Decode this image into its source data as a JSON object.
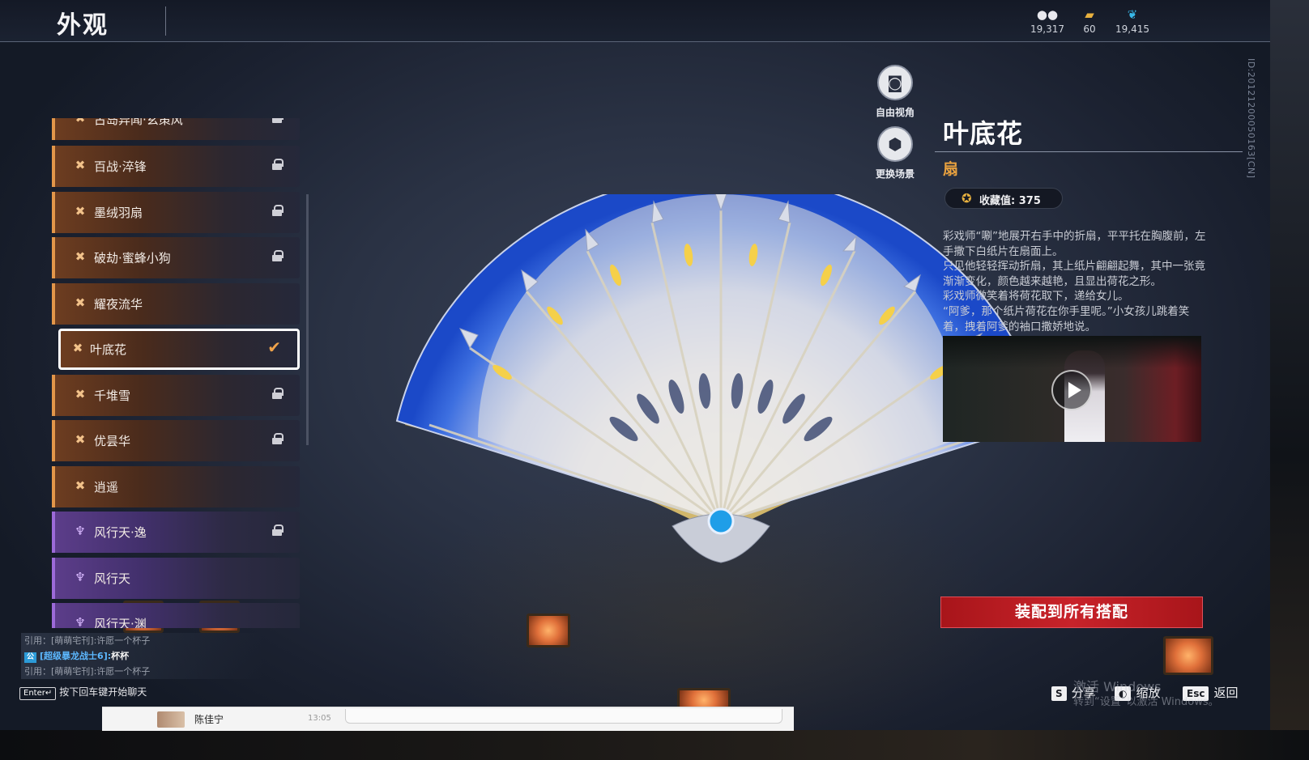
{
  "header": {
    "title": "外观",
    "currencies": [
      {
        "icon": "coin-stack-icon",
        "value": "19,317"
      },
      {
        "icon": "ticket-icon",
        "value": "60"
      },
      {
        "icon": "feather-icon",
        "value": "19,415"
      }
    ],
    "id_text": "ID:20121200050163[CN]"
  },
  "list": {
    "items": [
      {
        "label": "古岛异闻·玄策风",
        "locked": true,
        "color": "orange"
      },
      {
        "label": "百战·淬锋",
        "locked": true,
        "color": "orange"
      },
      {
        "label": "墨绒羽扇",
        "locked": true,
        "color": "orange"
      },
      {
        "label": "破劫·蜜蜂小狗",
        "locked": true,
        "color": "orange"
      },
      {
        "label": "耀夜流华",
        "locked": false,
        "color": "orange"
      },
      {
        "label": "叶底花",
        "locked": false,
        "selected": true,
        "color": "orange"
      },
      {
        "label": "千堆雪",
        "locked": true,
        "color": "orange"
      },
      {
        "label": "优昙华",
        "locked": true,
        "color": "orange"
      },
      {
        "label": "逍遥",
        "locked": false,
        "color": "orange"
      },
      {
        "label": "风行天·逸",
        "locked": true,
        "color": "purple"
      },
      {
        "label": "风行天",
        "locked": false,
        "color": "purple"
      },
      {
        "label": "风行天·渊",
        "locked": false,
        "color": "purple"
      }
    ]
  },
  "view_buttons": {
    "free_view": "自由视角",
    "change_scene": "更换场景"
  },
  "detail": {
    "name": "叶底花",
    "type": "扇",
    "collect_label": "收藏值: 375",
    "description": [
      "彩戏师“唰”地展开右手中的折扇，平平托在胸腹前，左手撒下白纸片在扇面上。",
      "只见他轻轻挥动折扇，其上纸片翩翩起舞，其中一张竟渐渐变化，颜色越来越艳，且显出荷花之形。",
      "彩戏师微笑着将荷花取下，递给女儿。",
      "“阿爹，那个纸片荷花在你手里呢。”小女孩儿跳着笑着，拽着阿爹的袖口撒娇地说。"
    ],
    "equip_button": "装配到所有搭配"
  },
  "chat": {
    "lines": [
      {
        "prefix": "引用：",
        "text": "[萌萌宅刊]:许愿一个杯子"
      },
      {
        "tag": "公",
        "user": "[超级暴龙战士6]:",
        "text": "杯杯"
      },
      {
        "prefix": "引用：",
        "text": "[萌萌宅刊]:许愿一个杯子"
      }
    ],
    "hint_key": "Enter↵",
    "hint_text": "按下回车键开始聊天"
  },
  "footer": {
    "share_key": "S",
    "share_label": "分享",
    "zoom_label": "缩放",
    "back_key": "Esc",
    "back_label": "返回"
  },
  "watermark": {
    "line1": "激活 Windows",
    "line2": "转到“设置”以激活 Windows。"
  },
  "popup": {
    "name": "陈佳宁",
    "time": "13:05"
  }
}
